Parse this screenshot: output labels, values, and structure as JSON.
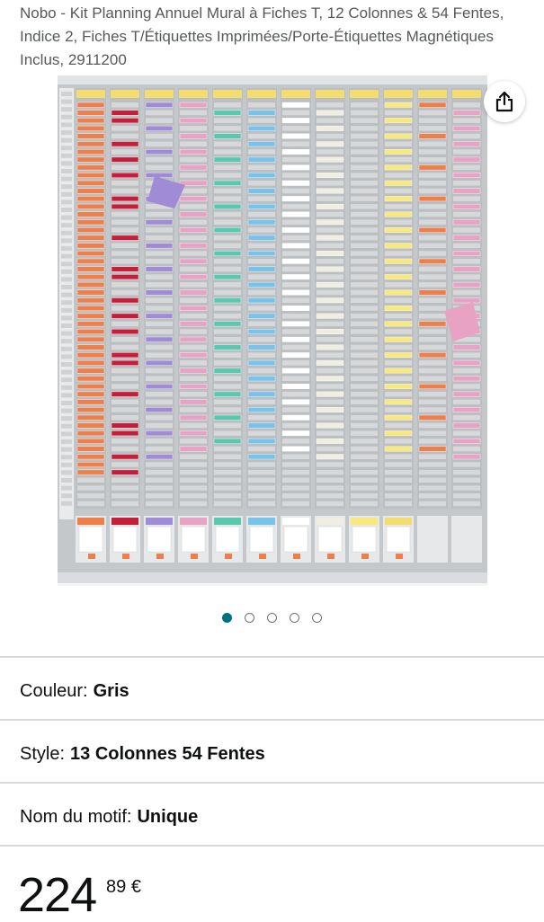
{
  "product": {
    "title": "Nobo - Kit Planning Annuel Mural à Fiches T, 12 Colonnes & 54 Fentes, Indice 2, Fiches T/Étiquettes Imprimées/Porte-Étiquettes Magnétiques Inclus, 2911200"
  },
  "gallery": {
    "image_count": 5,
    "active_index": 0,
    "share_icon": "share-icon"
  },
  "variations": {
    "color": {
      "label": "Couleur:",
      "value": "Gris"
    },
    "style": {
      "label": "Style:",
      "value": "13 Colonnes 54 Fentes"
    },
    "pattern": {
      "label": "Nom du motif:",
      "value": "Unique"
    }
  },
  "price": {
    "whole": "224",
    "fraction": "89",
    "currency": "€"
  },
  "colors": {
    "accent": "#007185",
    "board_gray": "#b9bcbf",
    "card_colors": [
      "#f2dd6e",
      "#ee7f4a",
      "#c41e3a",
      "#9f8bd6",
      "#e8a2c4",
      "#59c9ad",
      "#77c3ea",
      "#ffffff",
      "#f0eee0",
      "#f9e87c"
    ]
  }
}
